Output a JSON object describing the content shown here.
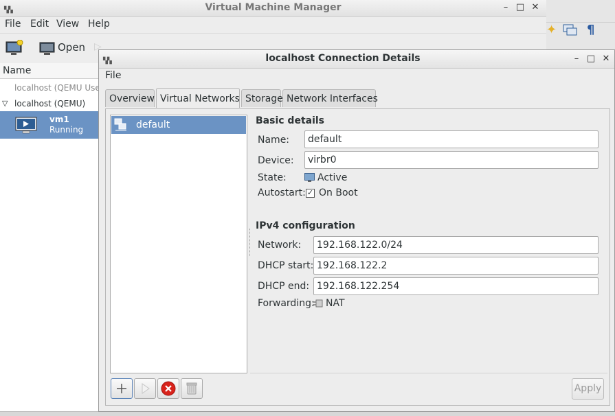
{
  "main_window": {
    "title": "Virtual Machine Manager",
    "menus": [
      "File",
      "Edit",
      "View",
      "Help"
    ],
    "toolbar": {
      "open_label": "Open"
    },
    "list_header": "Name",
    "connections": [
      {
        "label": "localhost (QEMU User"
      },
      {
        "label": "localhost (QEMU)"
      }
    ],
    "vm": {
      "name": "vm1",
      "status": "Running"
    }
  },
  "dialog": {
    "title": "localhost Connection Details",
    "menu": [
      "File"
    ],
    "tabs": [
      "Overview",
      "Virtual Networks",
      "Storage",
      "Network Interfaces"
    ],
    "active_tab": "Virtual Networks",
    "networks": [
      {
        "name": "default"
      }
    ],
    "basic": {
      "heading": "Basic details",
      "name_label": "Name:",
      "name_value": "default",
      "device_label": "Device:",
      "device_value": "virbr0",
      "state_label": "State:",
      "state_value": "Active",
      "autostart_label": "Autostart:",
      "autostart_value": "On Boot",
      "autostart_checked": true
    },
    "ipv4": {
      "heading": "IPv4 configuration",
      "network_label": "Network:",
      "network_value": "192.168.122.0/24",
      "dhcp_start_label": "DHCP start:",
      "dhcp_start_value": "192.168.122.2",
      "dhcp_end_label": "DHCP end:",
      "dhcp_end_value": "192.168.122.254",
      "forwarding_label": "Forwarding:",
      "forwarding_value": "NAT"
    },
    "buttons": {
      "apply_label": "Apply"
    },
    "icons": {
      "add": "plus-icon",
      "start": "play-icon",
      "stop": "stop-icon",
      "delete": "trash-icon",
      "network": "network-icon",
      "state": "monitor-icon",
      "forwarding": "plug-icon"
    },
    "colors": {
      "selection": "#6b93c4",
      "stop_red": "#d8231b"
    }
  }
}
